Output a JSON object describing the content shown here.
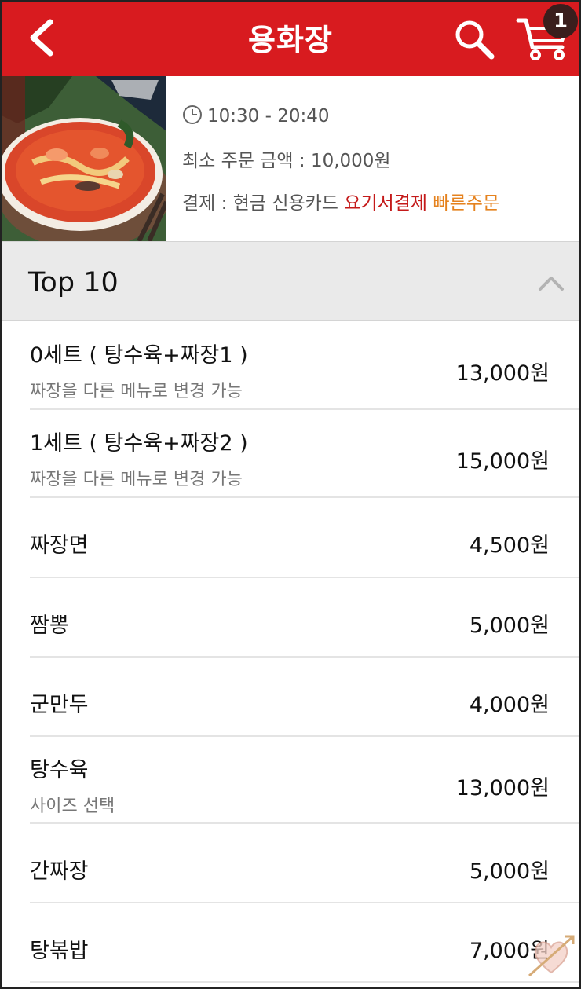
{
  "header": {
    "title": "용화장",
    "cart_count": "1",
    "background_color": "#d81b1f"
  },
  "restaurant": {
    "hours": "10:30 - 20:40",
    "min_order": "최소 주문 금액 : 10,000원",
    "payment_label": "결제 : 현금 신용카드",
    "payment_yogiyo": "요기서결제",
    "payment_fast": "빠른주문",
    "accent_red": "#c41a1a",
    "accent_orange": "#e5821e"
  },
  "section": {
    "title": "Top 10"
  },
  "menu_items": [
    {
      "name": "0세트 ( 탕수육+짜장1 )",
      "desc": "짜장을 다른 메뉴로 변경 가능",
      "price": "13,000원"
    },
    {
      "name": "1세트 ( 탕수육+짜장2 )",
      "desc": "짜장을 다른 메뉴로 변경 가능",
      "price": "15,000원"
    },
    {
      "name": "짜장면",
      "desc": "",
      "price": "4,500원"
    },
    {
      "name": "짬뽕",
      "desc": "",
      "price": "5,000원"
    },
    {
      "name": "군만두",
      "desc": "",
      "price": "4,000원"
    },
    {
      "name": "탕수육",
      "desc": "사이즈 선택",
      "price": "13,000원"
    },
    {
      "name": "간짜장",
      "desc": "",
      "price": "5,000원"
    },
    {
      "name": "탕볶밥",
      "desc": "",
      "price": "7,000원"
    }
  ]
}
